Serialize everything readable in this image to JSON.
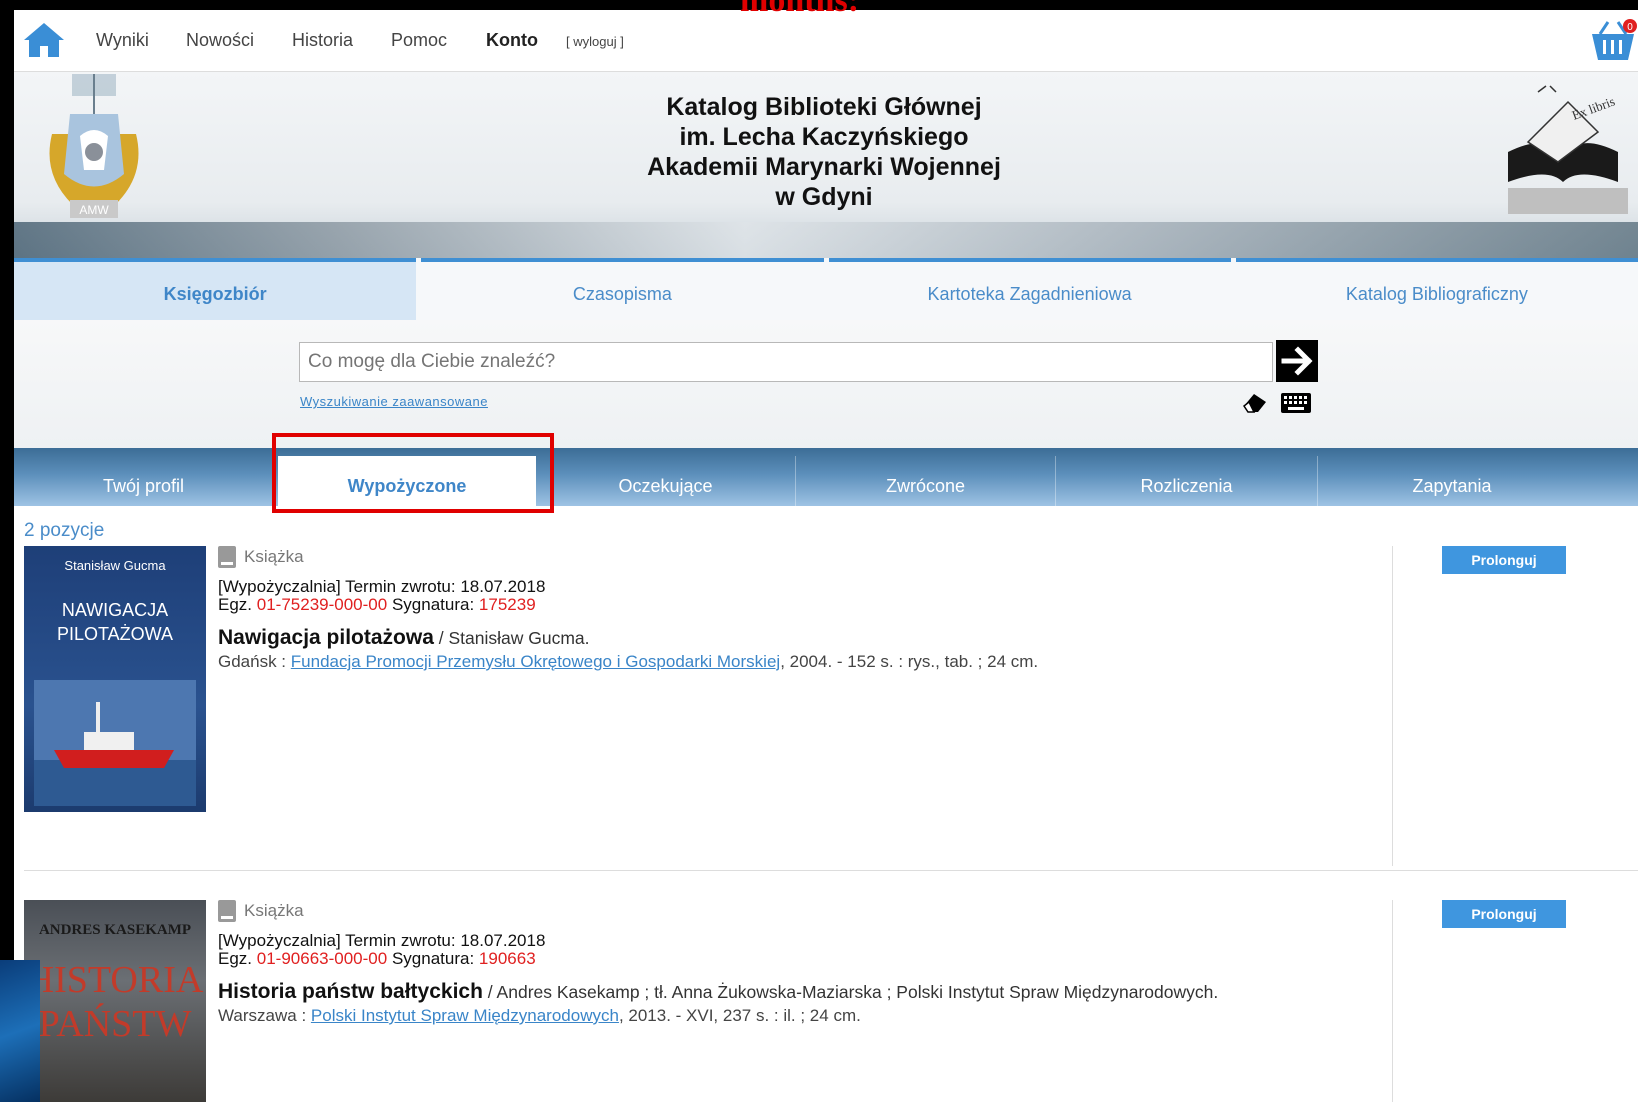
{
  "overlay": {
    "top_text": "months:"
  },
  "nav": {
    "items": [
      "Wyniki",
      "Nowości",
      "Historia",
      "Pomoc",
      "Konto"
    ],
    "logout": "[ wyloguj ]",
    "cart_count": "0"
  },
  "banner": {
    "title_lines": [
      "Katalog Biblioteki Głównej",
      "im. Lecha Kaczyńskiego",
      "Akademii Marynarki Wojennej",
      "w Gdyni"
    ],
    "amw_text": "AMW",
    "exlibris_text": "Ex libris"
  },
  "search_tabs": [
    "Księgozbiór",
    "Czasopisma",
    "Kartoteka Zagadnieniowa",
    "Katalog Bibliograficzny"
  ],
  "search": {
    "placeholder": "Co mogę dla Ciebie znaleźć?",
    "advanced": "Wyszukiwanie zaawansowane"
  },
  "account_tabs": [
    "Twój profil",
    "Wypożyczone",
    "Oczekujące",
    "Zwrócone",
    "Rozliczenia",
    "Zapytania"
  ],
  "results": {
    "count": "2 pozycje",
    "renew_label": "Prolonguj",
    "items": [
      {
        "type": "Książka",
        "due": "[Wypożyczalnia] Termin zwrotu: 18.07.2018",
        "egz_label": "Egz.",
        "egz": "01-75239-000-00",
        "sygn_label": "Sygnatura:",
        "sygn": "175239",
        "title": "Nawigacja pilotażowa",
        "resp": "/ Stanisław Gucma.",
        "place": "Gdańsk :",
        "publisher": "Fundacja Promocji Przemysłu Okrętowego i Gospodarki Morskiej",
        "details": ", 2004. - 152 s. : rys., tab. ; 24 cm.",
        "cover_author": "Stanisław Gucma",
        "cover_title_1": "NAWIGACJA",
        "cover_title_2": "PILOTAŻOWA"
      },
      {
        "type": "Książka",
        "due": "[Wypożyczalnia] Termin zwrotu: 18.07.2018",
        "egz_label": "Egz.",
        "egz": "01-90663-000-00",
        "sygn_label": "Sygnatura:",
        "sygn": "190663",
        "title": "Historia państw bałtyckich",
        "resp": "/ Andres Kasekamp ; tł. Anna Żukowska-Maziarska ; Polski Instytut Spraw Międzynarodowych.",
        "place": "Warszawa :",
        "publisher": "Polski Instytut Spraw Międzynarodowych",
        "details": ", 2013. - XVI, 237 s. : il. ; 24 cm.",
        "cover_author": "ANDRES KASEKAMP",
        "cover_title_1": "HISTORIA",
        "cover_title_2": "PAŃSTW"
      }
    ]
  }
}
